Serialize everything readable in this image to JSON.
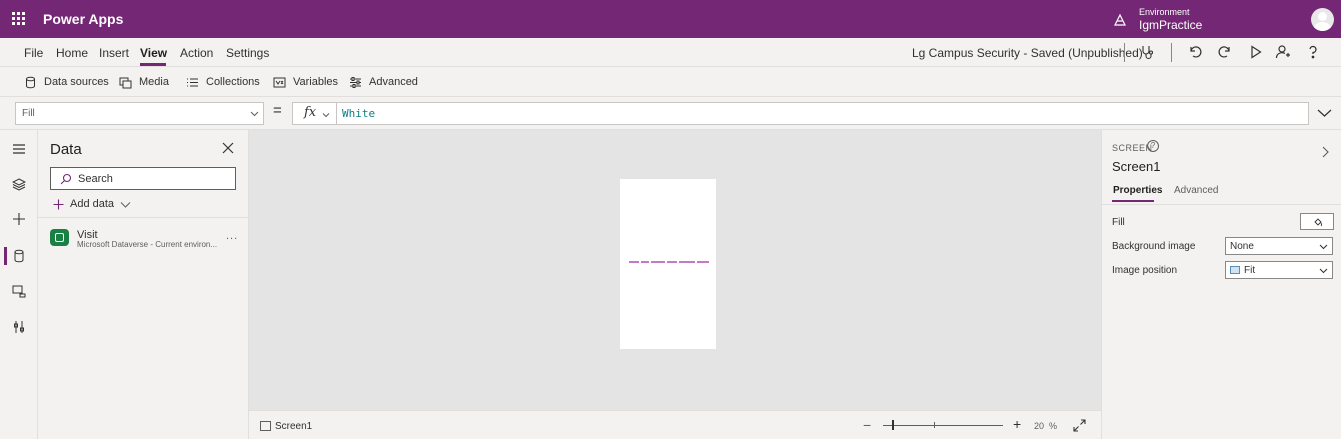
{
  "header": {
    "app_title": "Power Apps",
    "environment_label": "Environment",
    "environment_name": "IgmPractice"
  },
  "menu": {
    "items": [
      {
        "label": "File"
      },
      {
        "label": "Home"
      },
      {
        "label": "Insert"
      },
      {
        "label": "View"
      },
      {
        "label": "Action"
      },
      {
        "label": "Settings"
      }
    ],
    "active": "View",
    "doc_status": "Lg Campus Security - Saved (Unpublished)"
  },
  "toolbar_icons": [
    "stethoscope-icon",
    "undo-icon",
    "redo-icon",
    "play-icon",
    "share-user-icon",
    "help-icon"
  ],
  "ribbon": {
    "items": [
      {
        "label": "Data sources",
        "icon": "cylinder-icon"
      },
      {
        "label": "Media",
        "icon": "media-icon"
      },
      {
        "label": "Collections",
        "icon": "list-icon"
      },
      {
        "label": "Variables",
        "icon": "variables-icon"
      },
      {
        "label": "Advanced",
        "icon": "sliders-icon"
      }
    ]
  },
  "formula_bar": {
    "property": "Fill",
    "equals": "=",
    "fx_label": "fx",
    "formula": "White"
  },
  "data_pane": {
    "title": "Data",
    "search_placeholder": "Search",
    "add_data_label": "Add data",
    "sources": [
      {
        "name": "Visit",
        "subtitle": "Microsoft Dataverse - Current environ...",
        "more": "..."
      }
    ]
  },
  "status_bar": {
    "screen_name": "Screen1",
    "zoom_minus": "−",
    "zoom_plus": "+",
    "zoom_value": "20",
    "zoom_unit": "%"
  },
  "properties_panel": {
    "caption": "SCREEN",
    "help_glyph": "?",
    "name": "Screen1",
    "tabs": [
      {
        "label": "Properties"
      },
      {
        "label": "Advanced"
      }
    ],
    "active_tab": "Properties",
    "fill_label": "Fill",
    "background_image_label": "Background image",
    "background_image_value": "None",
    "image_position_label": "Image position",
    "image_position_value": "Fit"
  },
  "colors": {
    "brand": "#742774",
    "formula_text": "#0e7c86",
    "dataverse_icon": "#1a8144"
  }
}
